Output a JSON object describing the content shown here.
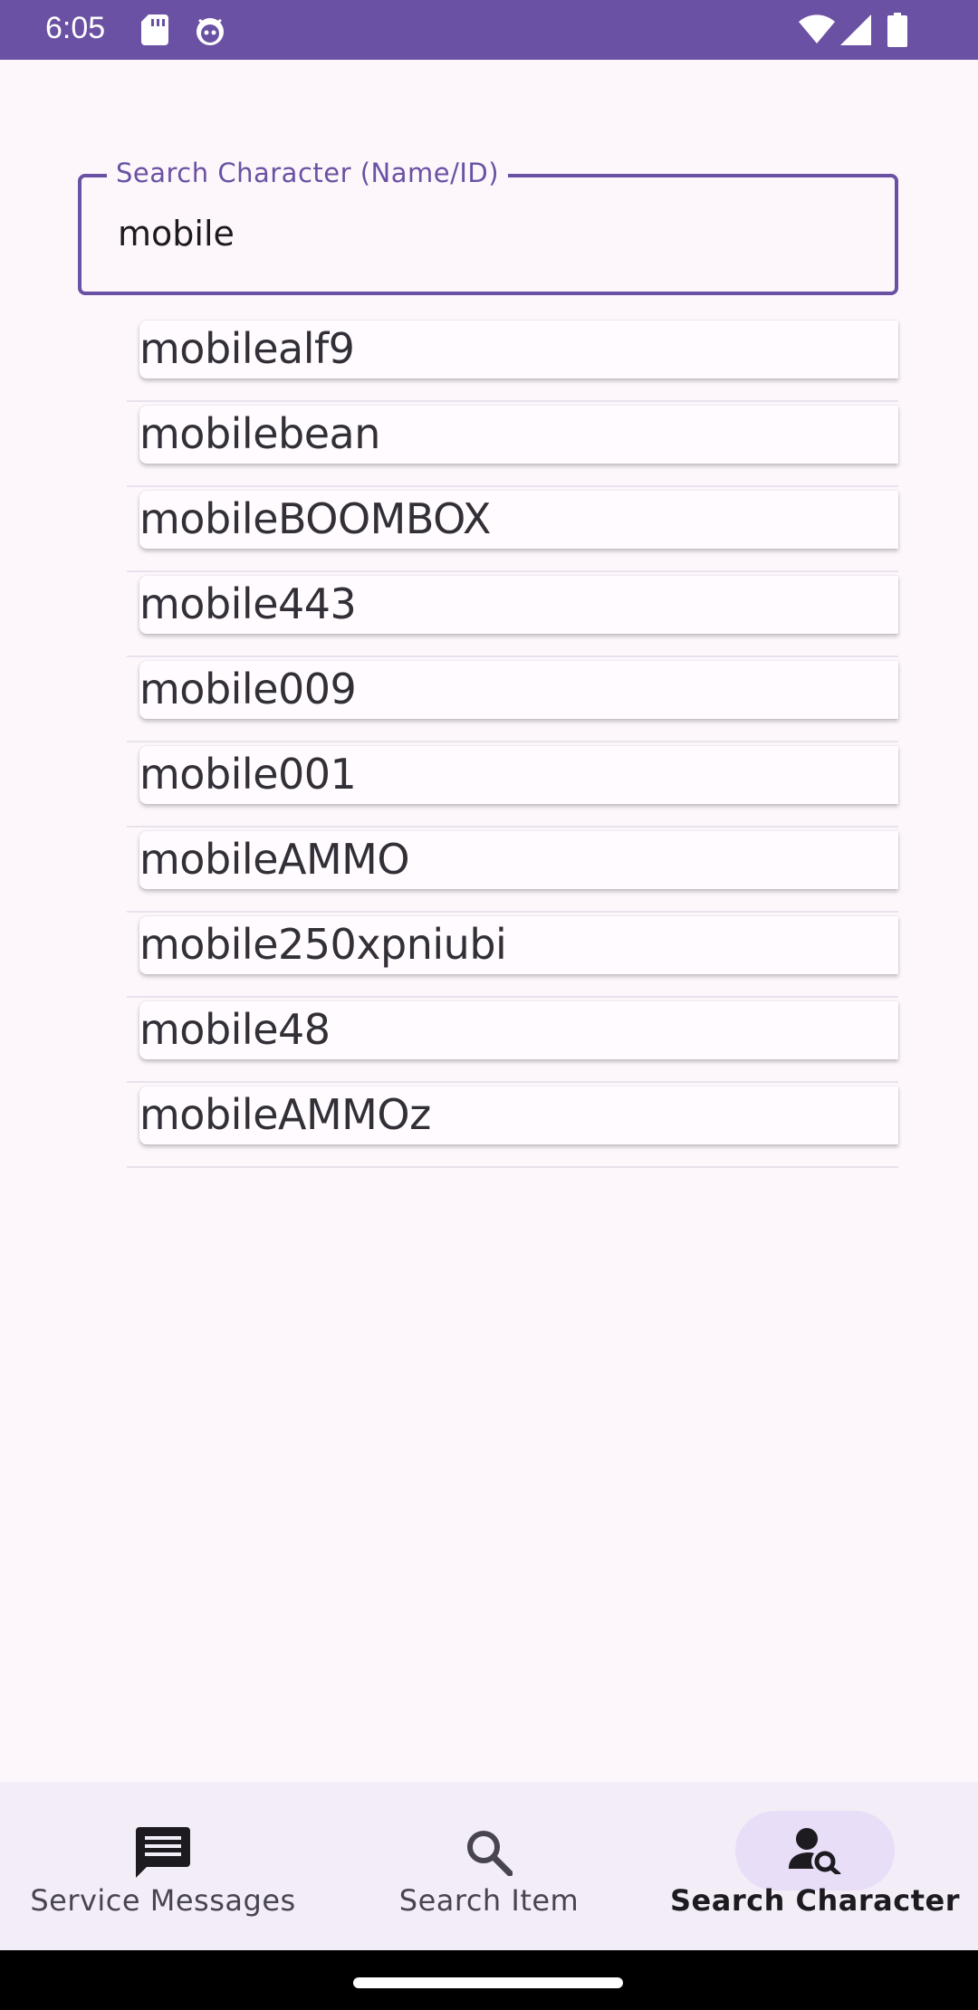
{
  "status_bar": {
    "time": "6:05",
    "left_icons": [
      "sd-card-icon",
      "bug-icon"
    ],
    "right_icons": [
      "wifi-icon",
      "signal-icon",
      "battery-icon"
    ]
  },
  "search": {
    "label": "Search Character (Name/ID)",
    "value": "mobile"
  },
  "results": [
    "mobilealf9",
    "mobilebean",
    "mobileBOOMBOX",
    "mobile443",
    "mobile009",
    "mobile001",
    "mobileAMMO",
    "mobile250xpniubi",
    "mobile48",
    "mobileAMMOz"
  ],
  "bottom_nav": {
    "items": [
      {
        "label": "Service Messages",
        "icon": "message-icon",
        "active": false
      },
      {
        "label": "Search Item",
        "icon": "search-icon",
        "active": false
      },
      {
        "label": "Search Character",
        "icon": "person-search-icon",
        "active": true
      }
    ]
  },
  "colors": {
    "primary": "#6a51a3",
    "background": "#fdf7fc",
    "nav_background": "#f3edf7",
    "active_indicator": "#e8def8"
  }
}
